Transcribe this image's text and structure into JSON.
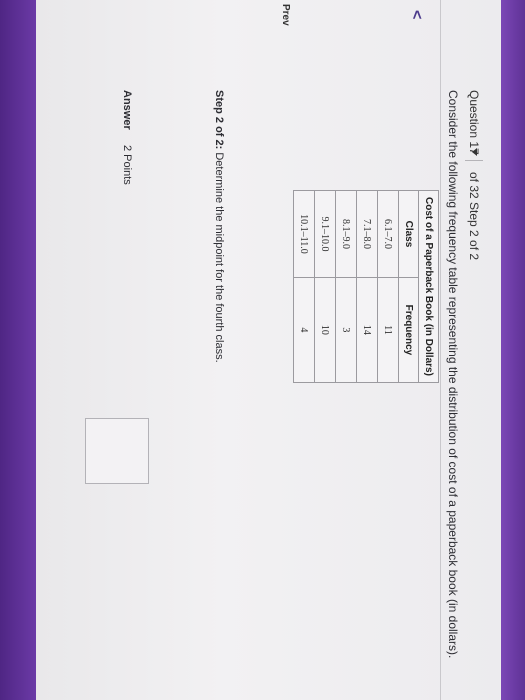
{
  "header": {
    "question_label": "Question 17",
    "step_of": "of 32 Step 2 of 2"
  },
  "intro": "Consider the following frequency table representing the distribution of cost of a paperback book (in dollars).",
  "nav": {
    "prev_arrow": "<",
    "prev_label": "Prev"
  },
  "table": {
    "title": "Cost of a Paperback Book (in Dollars)",
    "headers": [
      "Class",
      "Frequency"
    ],
    "rows": [
      {
        "class": "6.1–7.0",
        "frequency": "11"
      },
      {
        "class": "7.1–8.0",
        "frequency": "14"
      },
      {
        "class": "8.1–9.0",
        "frequency": "3"
      },
      {
        "class": "9.1–10.0",
        "frequency": "10"
      },
      {
        "class": "10.1–11.0",
        "frequency": "4"
      }
    ]
  },
  "step": {
    "prefix": "Step 2 of 2:",
    "text": " Determine the midpoint for the fourth class."
  },
  "answer": {
    "label": "Answer",
    "points": "2 Points",
    "value": ""
  },
  "colors": {
    "frame_purple": "#6a3aa0",
    "screen": "#efeef1"
  }
}
